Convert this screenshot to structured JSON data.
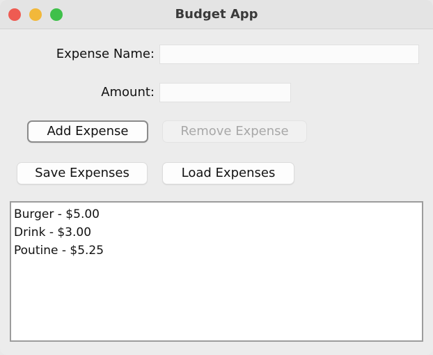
{
  "window": {
    "title": "Budget App"
  },
  "form": {
    "expense_name_label": "Expense Name:",
    "expense_name_value": "",
    "amount_label": "Amount:",
    "amount_value": ""
  },
  "buttons": {
    "add_expense": "Add Expense",
    "remove_expense": "Remove Expense",
    "save_expenses": "Save Expenses",
    "load_expenses": "Load Expenses"
  },
  "expenses": [
    "Burger - $5.00",
    "Drink - $3.00",
    "Poutine - $5.25"
  ],
  "colors": {
    "close": "#ee5b52",
    "minimize": "#f2b83a",
    "maximize": "#3fc04a"
  }
}
